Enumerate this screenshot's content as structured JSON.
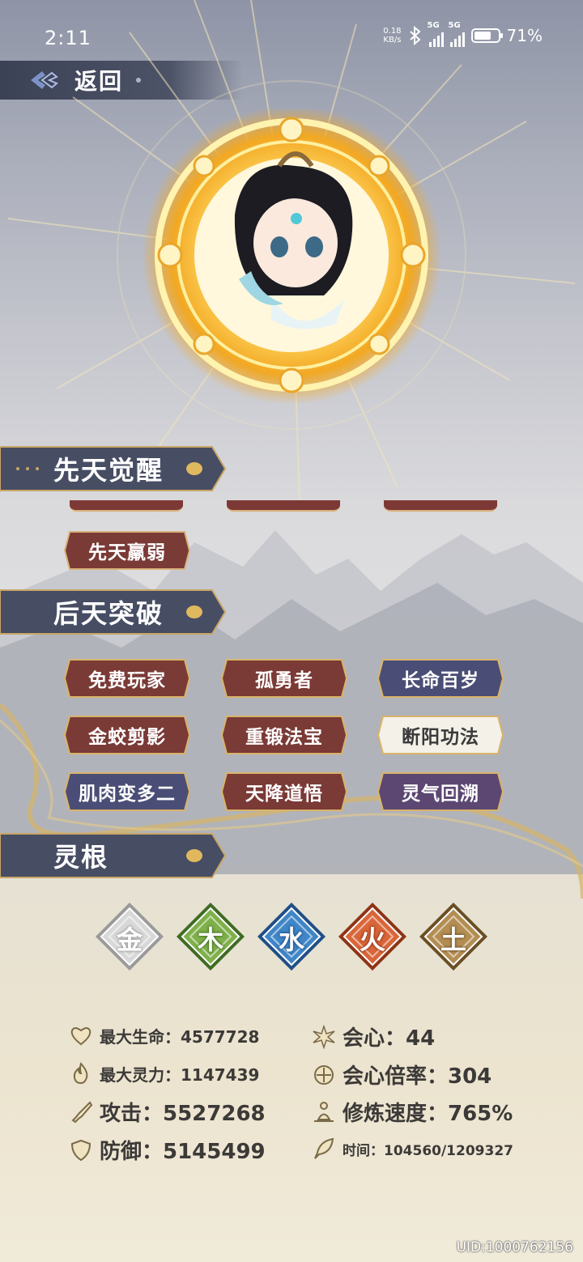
{
  "status_bar": {
    "time": "2:11",
    "net_speed_value": "0.18",
    "net_speed_unit": "KB/s",
    "signal1_label": "5G",
    "signal2_label": "5G",
    "battery": "71%",
    "battery_level": 0.71
  },
  "header": {
    "back_label": "返回"
  },
  "sections": {
    "innate": "先天觉醒",
    "acquired": "后天突破",
    "spirit_root": "灵根"
  },
  "innate_tags": [
    "先天羸弱"
  ],
  "acquired_tags": [
    {
      "label": "免费玩家",
      "style": "red"
    },
    {
      "label": "孤勇者",
      "style": "red"
    },
    {
      "label": "长命百岁",
      "style": "blue"
    },
    {
      "label": "金蛟剪影",
      "style": "red"
    },
    {
      "label": "重锻法宝",
      "style": "red"
    },
    {
      "label": "断阳功法",
      "style": "white"
    },
    {
      "label": "肌肉变多二",
      "style": "blue"
    },
    {
      "label": "天降道悟",
      "style": "red"
    },
    {
      "label": "灵气回溯",
      "style": "purple"
    }
  ],
  "elements": [
    {
      "char": "金",
      "color": "#d8d8d8",
      "accent": "#9a9a9a"
    },
    {
      "char": "木",
      "color": "#7fb04a",
      "accent": "#3f6b23"
    },
    {
      "char": "水",
      "color": "#3f86c7",
      "accent": "#1f4f86"
    },
    {
      "char": "火",
      "color": "#d9663a",
      "accent": "#8e3416"
    },
    {
      "char": "土",
      "color": "#b38d52",
      "accent": "#6a4f25"
    }
  ],
  "stats": {
    "max_hp": "最大生命：4577728",
    "crit": "会心：44",
    "max_mp": "最大灵力：1147439",
    "crit_rate": "会心倍率：304",
    "attack": "攻击：5527268",
    "cultivate_speed": "修炼速度：765%",
    "defense": "防御：5145499",
    "time": "时间：104560/1209327"
  },
  "uid": "UID:1000762156",
  "colors": {
    "tag_red": "#7a3a36",
    "tag_blue": "#4a4d75",
    "tag_purple": "#5b4772",
    "tag_white": "#f4f1e8",
    "gold": "#d9b36a",
    "header_bg": "#474d63"
  }
}
